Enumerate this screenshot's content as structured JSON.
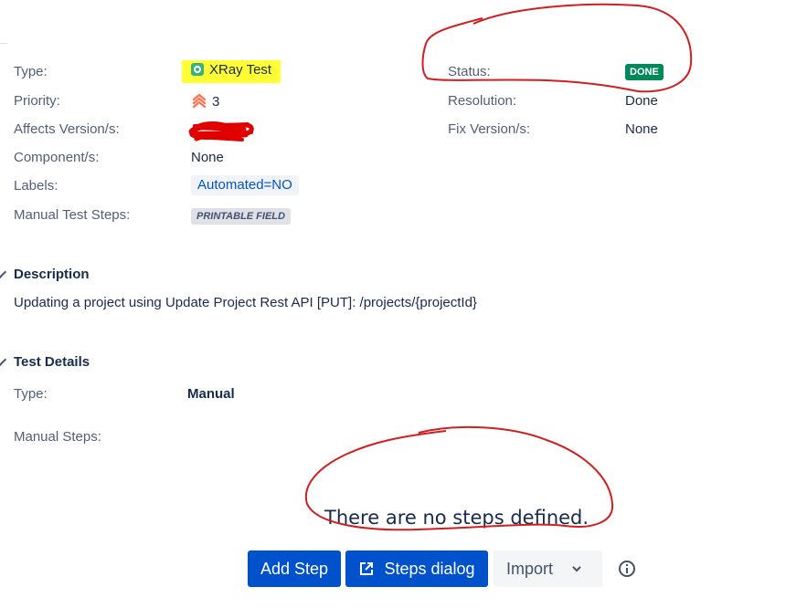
{
  "details": {
    "left": [
      {
        "label": "Type:",
        "value": "XRay Test"
      },
      {
        "label": "Priority:",
        "value": "3"
      },
      {
        "label": "Affects Version/s:",
        "value": ""
      },
      {
        "label": "Component/s:",
        "value": "None"
      },
      {
        "label": "Labels:",
        "value": "Automated=NO"
      },
      {
        "label": "Manual Test Steps:",
        "value": "PRINTABLE FIELD"
      }
    ],
    "right": [
      {
        "label": "Status:",
        "value": "DONE"
      },
      {
        "label": "Resolution:",
        "value": "Done"
      },
      {
        "label": "Fix Version/s:",
        "value": "None"
      }
    ]
  },
  "description": {
    "title": "Description",
    "text": "Updating a project using Update Project Rest API [PUT]: /projects/{projectId}"
  },
  "test_details": {
    "title": "Test Details",
    "type_label": "Type:",
    "type_value": "Manual",
    "steps_label": "Manual Steps:",
    "empty_message": "There are no steps defined."
  },
  "actions": {
    "add_step": "Add Step",
    "steps_dialog": "Steps dialog",
    "import": "Import"
  },
  "colors": {
    "status_done": "#00875a",
    "primary_button": "#0052cc",
    "highlight": "#ffff33",
    "annotation": "#d11f1f"
  },
  "icons": {
    "issue_type": "xray-test-icon",
    "priority": "priority-medium-icon",
    "steps_dialog": "external-link-icon",
    "import": "chevron-down-icon",
    "info": "info-icon"
  }
}
